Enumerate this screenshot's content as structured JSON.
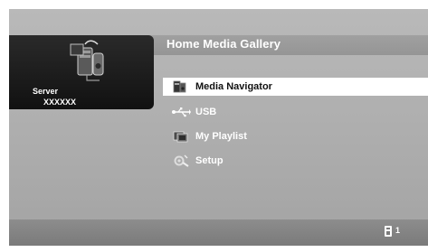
{
  "header": {
    "title": "Home Media Gallery"
  },
  "server": {
    "label": "Server",
    "name": "XXXXXX",
    "icon": "server-icon"
  },
  "menu": {
    "items": [
      {
        "label": "Media Navigator",
        "icon": "media-navigator-icon",
        "selected": true
      },
      {
        "label": "USB",
        "icon": "usb-icon",
        "selected": false
      },
      {
        "label": "My Playlist",
        "icon": "playlist-icon",
        "selected": false
      },
      {
        "label": "Setup",
        "icon": "setup-icon",
        "selected": false
      }
    ]
  },
  "footer": {
    "count": "1",
    "icon": "device-icon"
  },
  "colors": {
    "panel": "#b0b0b0",
    "server_box": "#1a1a1a",
    "selection": "#ffffff",
    "footer": "#848484"
  }
}
